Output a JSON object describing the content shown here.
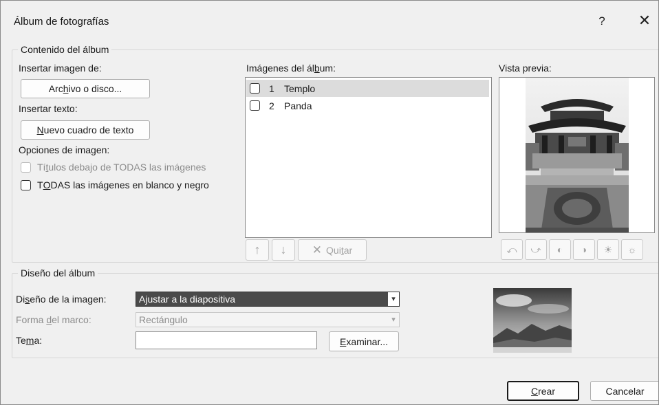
{
  "dialog": {
    "title": "Álbum de fotografías",
    "help_glyph": "?",
    "close_glyph": "✕"
  },
  "content": {
    "legend": "Contenido del álbum",
    "insert_image_label": "Insertar imagen de:",
    "file_button": {
      "pre": "Arc",
      "key": "h",
      "post": "ivo o disco..."
    },
    "insert_text_label": "Insertar texto:",
    "new_textbox_button": {
      "key": "N",
      "post": "uevo cuadro de texto"
    },
    "image_options_label": "Opciones de imagen:",
    "captions_option": {
      "pre": "Tí",
      "key": "t",
      "post": "ulos debajo de TODAS las imágenes",
      "checked": false,
      "enabled": false
    },
    "bw_option": {
      "pre": "T",
      "key": "O",
      "post": "DAS las imágenes en blanco y negro",
      "checked": false,
      "enabled": true
    },
    "album_images_label": {
      "pre": "Imágenes del ál",
      "key": "b",
      "post": "um:"
    },
    "images": [
      {
        "num": "1",
        "name": "Templo",
        "selected": true,
        "checked": false
      },
      {
        "num": "2",
        "name": "Panda",
        "selected": false,
        "checked": false
      }
    ],
    "move_up_icon": "↑",
    "move_down_icon": "↓",
    "remove_button": {
      "icon": "✕",
      "pre": "Qui",
      "key": "t",
      "post": "ar"
    },
    "preview_label": "Vista previa:",
    "preview_tools": [
      "rotate-left-icon",
      "rotate-right-icon",
      "contrast-increase-icon",
      "contrast-decrease-icon",
      "brightness-increase-icon",
      "brightness-decrease-icon"
    ]
  },
  "layout": {
    "legend": "Diseño del álbum",
    "picture_layout_label": {
      "pre": "Di",
      "key": "s",
      "post": "eño de la imagen:"
    },
    "picture_layout_value": "Ajustar a la diapositiva",
    "frame_shape_label": {
      "pre": "Forma ",
      "key": "d",
      "post": "el marco:"
    },
    "frame_shape_value": "Rectángulo",
    "theme_label": {
      "pre": "Te",
      "key": "m",
      "post": "a:"
    },
    "theme_value": "",
    "browse_button": {
      "key": "E",
      "post": "xaminar..."
    }
  },
  "footer": {
    "create_button": {
      "key": "C",
      "post": "rear"
    },
    "cancel_button": "Cancelar"
  },
  "colors": {
    "dialog_bg": "#f0f0f0",
    "selected_row": "#dcdcdc",
    "active_select": "#4a4a4a"
  }
}
